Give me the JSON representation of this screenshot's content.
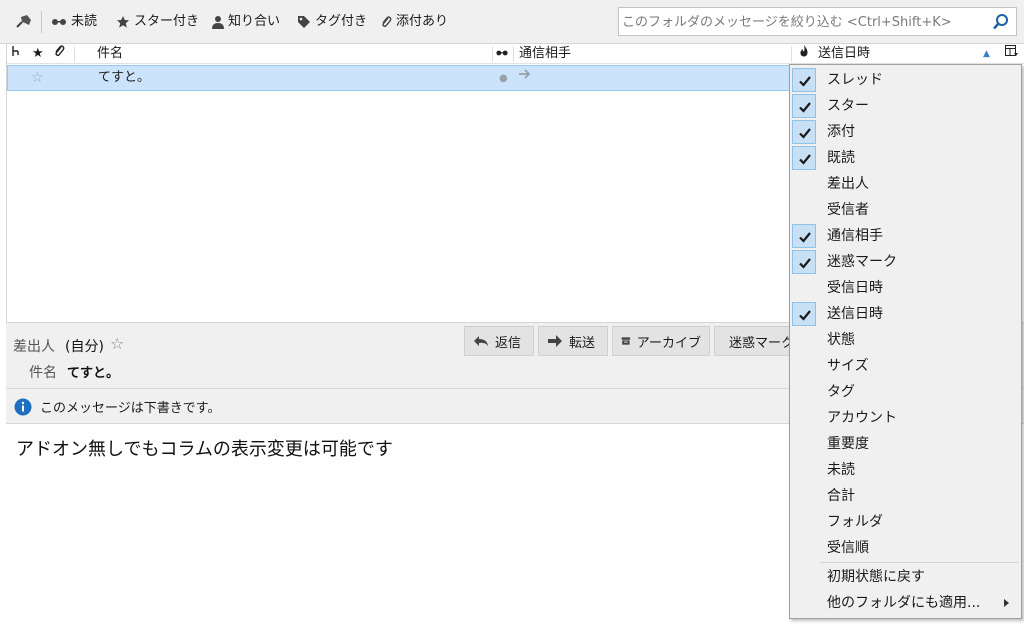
{
  "quick_filter": {
    "unread": "未読",
    "starred": "スター付き",
    "contacts": "知り合い",
    "tags": "タグ付き",
    "attachment": "添付あり",
    "search_placeholder": "このフォルダのメッセージを絞り込む <Ctrl+Shift+K>"
  },
  "thread_columns": {
    "subject": "件名",
    "correspondents": "通信相手",
    "date": "送信日時"
  },
  "thread_rows": [
    {
      "subject": "てすと。"
    }
  ],
  "message_header": {
    "from_label": "差出人",
    "from_value": "(自分)",
    "subject_label": "件名",
    "subject_value": "てすと。",
    "buttons": {
      "reply": "返信",
      "forward": "転送",
      "archive": "アーカイブ",
      "junk": "迷惑マーク"
    }
  },
  "notification": "このメッセージは下書きです。",
  "body_text": "アドオン無しでもコラムの表示変更は可能です",
  "column_menu": {
    "items": [
      {
        "label": "スレッド",
        "checked": true
      },
      {
        "label": "スター",
        "checked": true
      },
      {
        "label": "添付",
        "checked": true
      },
      {
        "label": "既読",
        "checked": true
      },
      {
        "label": "差出人",
        "checked": false
      },
      {
        "label": "受信者",
        "checked": false
      },
      {
        "label": "通信相手",
        "checked": true
      },
      {
        "label": "迷惑マーク",
        "checked": true
      },
      {
        "label": "受信日時",
        "checked": false
      },
      {
        "label": "送信日時",
        "checked": true
      },
      {
        "label": "状態",
        "checked": false
      },
      {
        "label": "サイズ",
        "checked": false
      },
      {
        "label": "タグ",
        "checked": false
      },
      {
        "label": "アカウント",
        "checked": false
      },
      {
        "label": "重要度",
        "checked": false
      },
      {
        "label": "未読",
        "checked": false
      },
      {
        "label": "合計",
        "checked": false
      },
      {
        "label": "フォルダ",
        "checked": false
      },
      {
        "label": "受信順",
        "checked": false
      }
    ],
    "restore": "初期状態に戻す",
    "apply_to_others": "他のフォルダにも適用..."
  },
  "colors": {
    "selection": "#cce4fb",
    "info_icon": "#1e6fc0",
    "checkbox_bg": "#c7e0f5"
  }
}
